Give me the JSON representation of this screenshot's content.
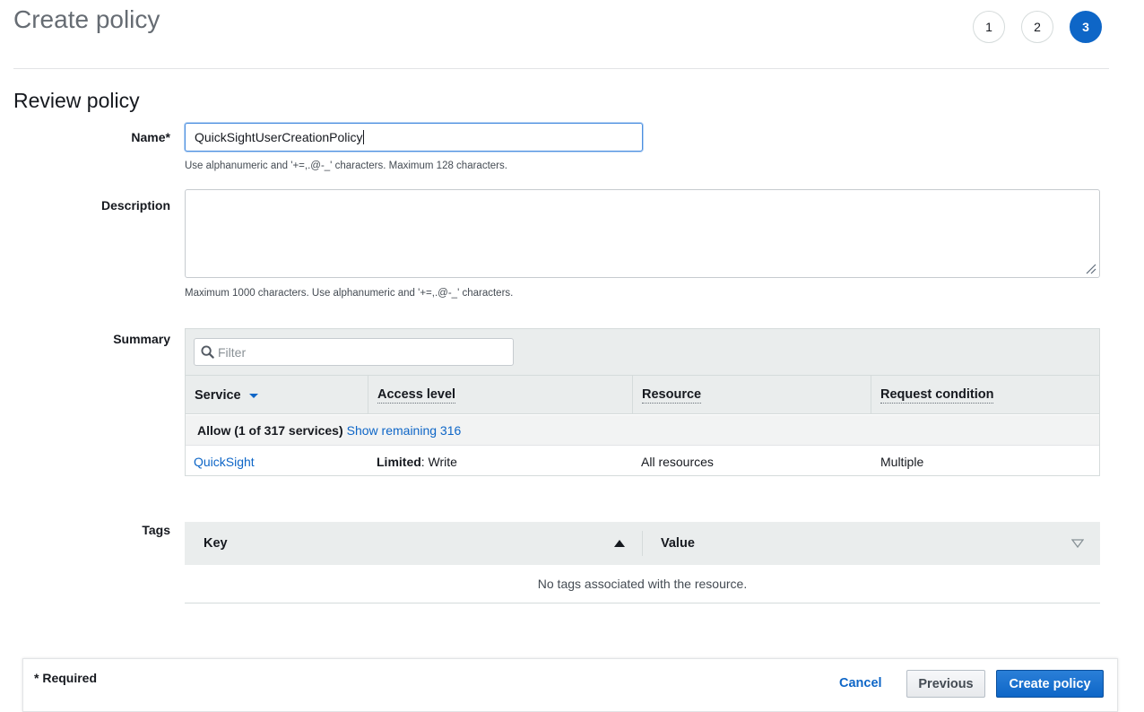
{
  "header": {
    "title": "Create policy",
    "steps": [
      "1",
      "2",
      "3"
    ],
    "active_step": "3"
  },
  "review": {
    "title": "Review policy",
    "name": {
      "label": "Name*",
      "value": "QuickSightUserCreationPolicy",
      "hint": "Use alphanumeric and '+=,.@-_' characters. Maximum 128 characters."
    },
    "description": {
      "label": "Description",
      "value": "",
      "hint": "Maximum 1000 characters. Use alphanumeric and '+=,.@-_' characters."
    },
    "summary": {
      "label": "Summary",
      "filter_placeholder": "Filter",
      "columns": [
        "Service",
        "Access level",
        "Resource",
        "Request condition"
      ],
      "group_bold": "Allow (1 of 317 services)",
      "group_link": "Show remaining 316",
      "rows": [
        {
          "service": "QuickSight",
          "access_bold": "Limited",
          "access_rest": ": Write",
          "resource": "All resources",
          "condition": "Multiple"
        }
      ]
    },
    "tags": {
      "label": "Tags",
      "columns": [
        "Key",
        "Value"
      ],
      "empty": "No tags associated with the resource."
    }
  },
  "footer": {
    "required": "* Required",
    "cancel": "Cancel",
    "previous": "Previous",
    "create": "Create policy"
  },
  "colors": {
    "accent": "#0e66c7",
    "link": "#0e66c7",
    "header_bg": "#eaeded"
  },
  "icons": {
    "filter": "search-icon",
    "service_sort": "caret-down-icon",
    "key_sort": "triangle-up-icon",
    "value_sort": "triangle-down-icon",
    "resize": "resize-grip-icon"
  }
}
